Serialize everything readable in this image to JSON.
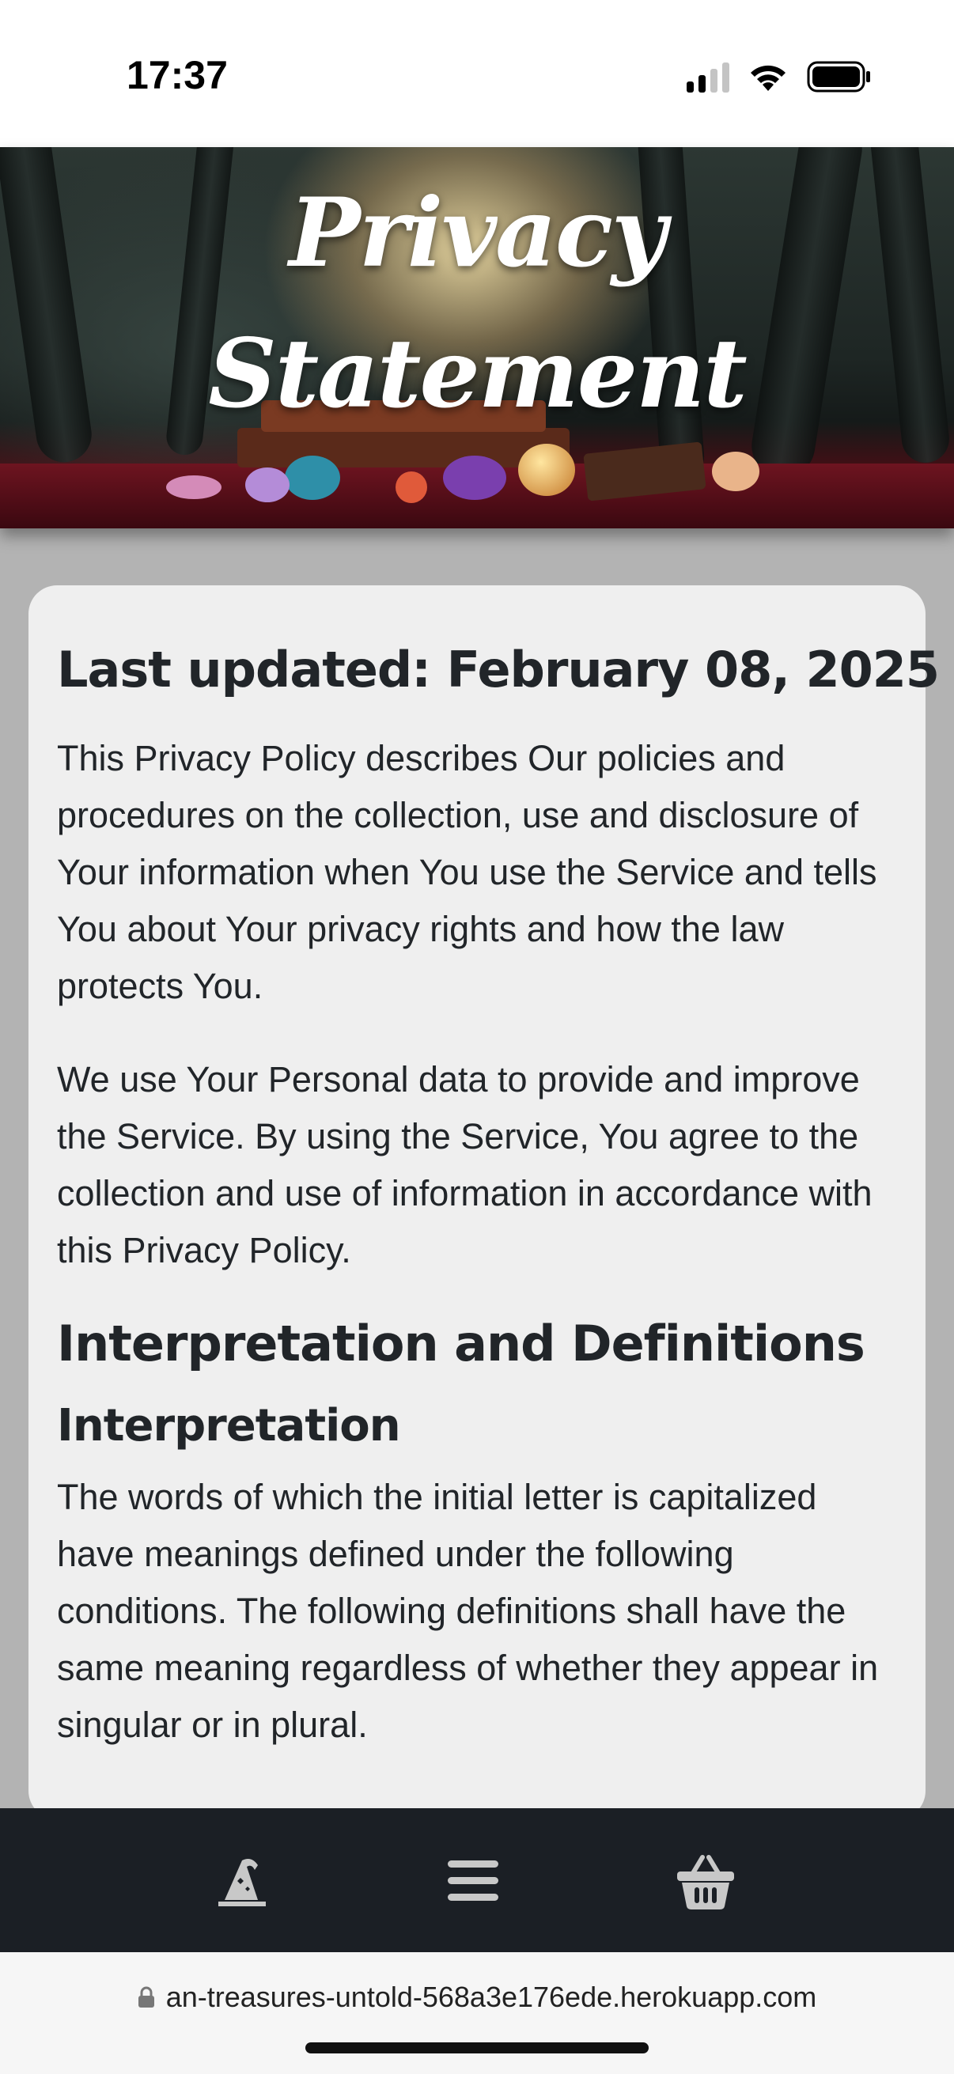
{
  "status_bar": {
    "time": "17:37",
    "icons": [
      "cellular-signal-icon",
      "wifi-icon",
      "battery-icon"
    ]
  },
  "banner": {
    "title_line1": "Privacy",
    "title_line2": "Statement"
  },
  "content": {
    "last_updated": "Last updated: February 08, 2025",
    "intro_paragraph_1": "This Privacy Policy describes Our policies and procedures on the collection, use and disclosure of Your information when You use the Service and tells You about Your privacy rights and how the law protects You.",
    "intro_paragraph_2": "We use Your Personal data to provide and improve the Service. By using the Service, You agree to the collection and use of information in accordance with this Privacy Policy.",
    "section_heading": "Interpretation and Definitions",
    "subsection_heading": "Interpretation",
    "interpretation_paragraph": "The words of which the initial letter is capitalized have meanings defined under the following conditions. The following definitions shall have the same meaning regardless of whether they appear in singular or in plural."
  },
  "bottom_nav": {
    "items": [
      "wizard-hat-icon",
      "menu-icon",
      "basket-icon"
    ]
  },
  "address_bar": {
    "url": "an-treasures-untold-568a3e176ede.herokuapp.com"
  },
  "colors": {
    "page_background": "#b3b3b3",
    "card_background": "#efefef",
    "text": "#212529",
    "nav_background": "#1b1f25",
    "nav_icon": "#c8c8c8"
  }
}
